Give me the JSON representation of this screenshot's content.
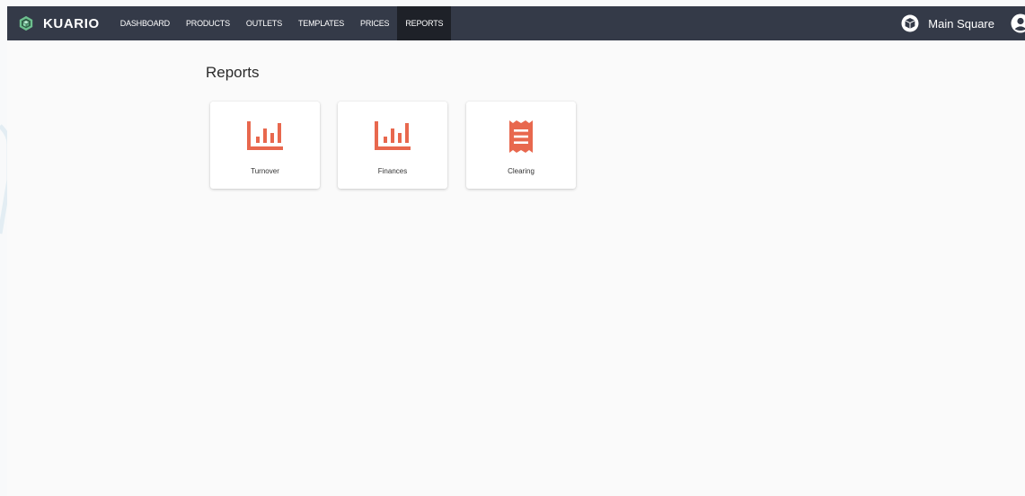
{
  "app": {
    "brand": "KUARIO"
  },
  "nav": {
    "items": [
      {
        "label": "DASHBOARD",
        "active": false
      },
      {
        "label": "PRODUCTS",
        "active": false
      },
      {
        "label": "OUTLETS",
        "active": false
      },
      {
        "label": "TEMPLATES",
        "active": false
      },
      {
        "label": "PRICES",
        "active": false
      },
      {
        "label": "REPORTS",
        "active": true
      }
    ],
    "outlet_name": "Main Square"
  },
  "page": {
    "title": "Reports"
  },
  "reports": [
    {
      "label": "Turnover",
      "icon": "bar-chart-icon"
    },
    {
      "label": "Finances",
      "icon": "bar-chart-icon"
    },
    {
      "label": "Clearing",
      "icon": "receipt-icon"
    }
  ],
  "colors": {
    "navbar": "#343a48",
    "nav_active": "#1e2128",
    "accent": "#e8684e",
    "background": "#fafafa"
  }
}
